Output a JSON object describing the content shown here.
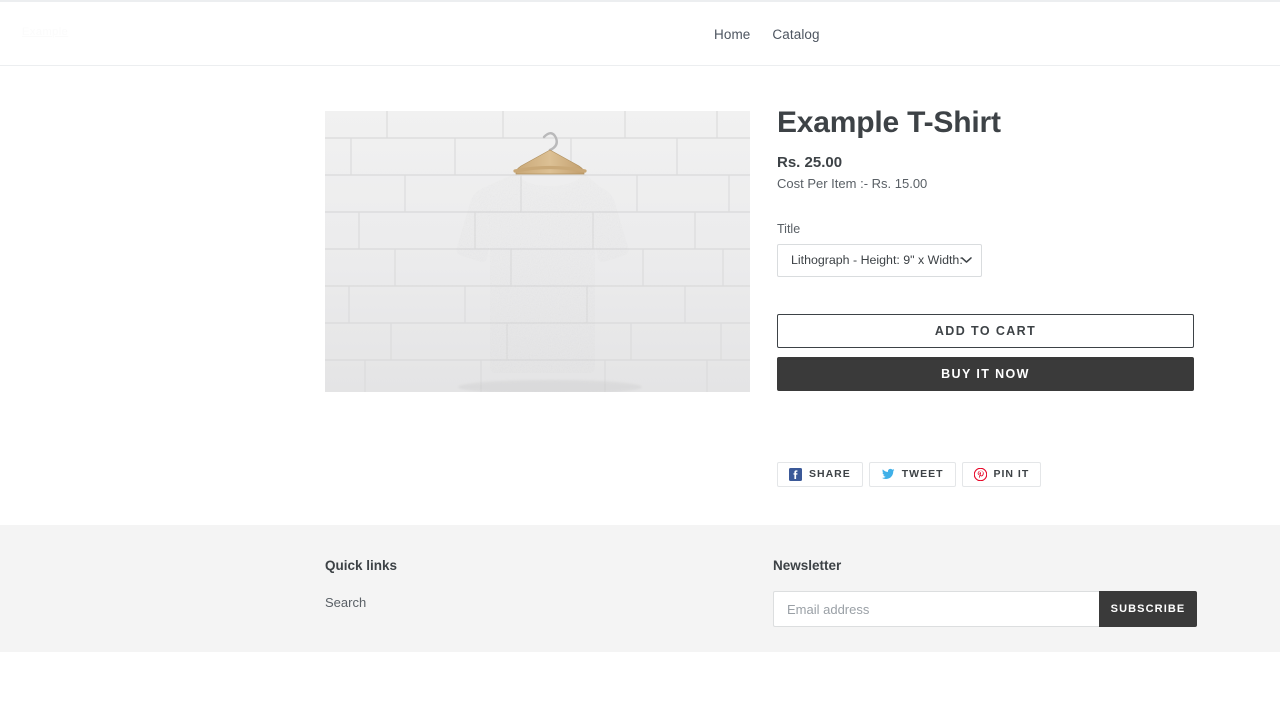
{
  "header": {
    "logo_text": "Example",
    "nav": [
      {
        "label": "Home",
        "name": "nav-link-home"
      },
      {
        "label": "Catalog",
        "name": "nav-link-catalog"
      }
    ]
  },
  "product": {
    "image_alt": "Green heather t-shirt on wooden hanger against white brick wall",
    "title": "Example T-Shirt",
    "price": "Rs. 25.00",
    "cost_per_item": "Cost Per Item :- Rs. 15.00",
    "option_label": "Title",
    "option_selected": "Lithograph - Height: 9\" x Width:",
    "add_to_cart_label": "ADD TO CART",
    "buy_now_label": "BUY IT NOW"
  },
  "share": [
    {
      "label": "SHARE",
      "icon": "facebook-icon",
      "color": "#3b5998"
    },
    {
      "label": "TWEET",
      "icon": "twitter-icon",
      "color": "#40b0e8"
    },
    {
      "label": "PIN IT",
      "icon": "pinterest-icon",
      "color": "#e60023"
    }
  ],
  "footer": {
    "quick_links_title": "Quick links",
    "quick_links": [
      {
        "label": "Search",
        "name": "footer-link-search"
      }
    ],
    "newsletter_title": "Newsletter",
    "email_placeholder": "Email address",
    "email_value": "",
    "subscribe_label": "SUBSCRIBE"
  },
  "colors": {
    "accent_dark": "#3a3a3a",
    "text": "#3d4246",
    "footer_bg": "#f4f4f4",
    "shirt_green": "#6f8f6c",
    "wall": "#ededee"
  }
}
